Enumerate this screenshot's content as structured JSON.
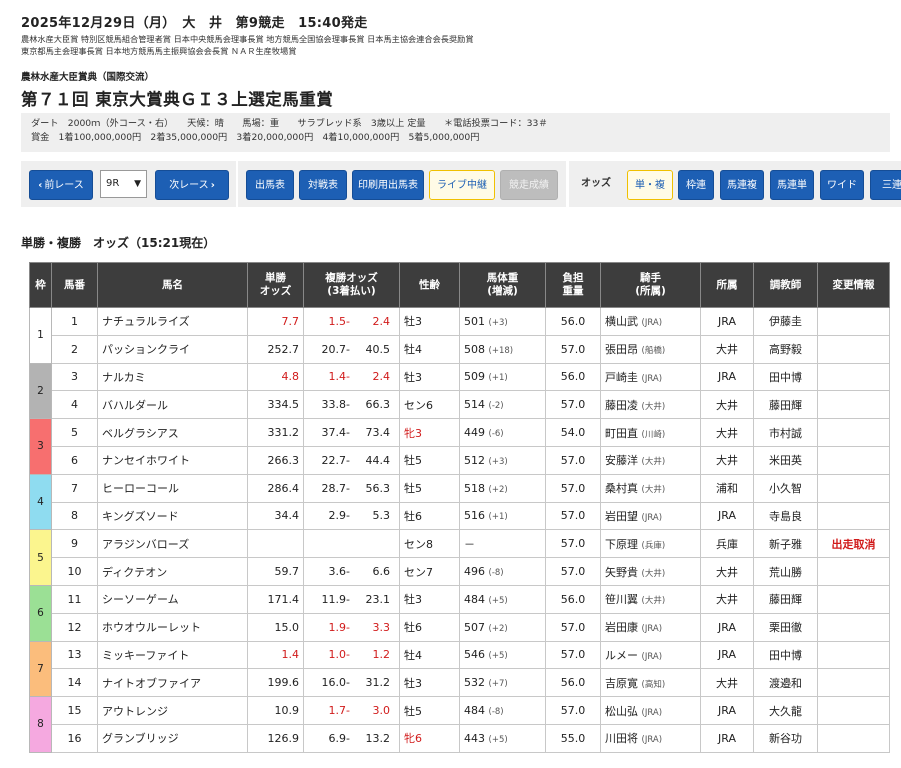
{
  "header": {
    "date_line": "2025年12月29日（月）　大　井　第9競走　15:40発走",
    "sponsors": [
      "農林水産大臣賞 特別区競馬組合管理者賞 日本中央競馬会理事長賞 地方競馬全国協会理事長賞 日本馬主協会連合会長奨励賞",
      "東京都馬主会理事長賞 日本地方競馬馬主振興協会会長賞 ＮＡＲ生産牧場賞"
    ],
    "subtitle": "農林水産大臣賞典（国際交流）",
    "title": "第７１回 東京大賞典ＧＩ３上選定馬重賞"
  },
  "info": {
    "line1": "ダート　2000ｍ（外コース・右）　　天候：晴　　馬場：重　　サラブレッド系　3歳以上 定量　　＊電話投票コード：33＃",
    "line2": "賞金　1着100,000,000円　2着35,000,000円　3着20,000,000円　4着10,000,000円　5着5,000,000円"
  },
  "nav": {
    "prev_label": "前レース",
    "race_select": "9R",
    "next_label": "次レース",
    "mid_buttons": [
      "出馬表",
      "対戦表",
      "印刷用出馬表",
      "ライブ中継",
      "競走成績"
    ],
    "odds_label": "オッズ",
    "odds_buttons": [
      "単・複",
      "枠連",
      "馬連複",
      "馬連単",
      "ワイド",
      "三連"
    ]
  },
  "section_title": "単勝・複勝　オッズ（15:21現在）",
  "table": {
    "headers": {
      "waku": "枠",
      "umaban": "馬番",
      "name": "馬名",
      "win1": "単勝",
      "win2": "オッズ",
      "place1": "複勝オッズ",
      "place2": "(3着払い)",
      "sexage": "性齢",
      "weight1": "馬体重",
      "weight2": "(増減)",
      "burden1": "負担",
      "burden2": "重量",
      "jockey1": "騎手",
      "jockey2": "(所属)",
      "belong": "所属",
      "trainer": "調教師",
      "change": "変更情報"
    },
    "waku_groups": [
      {
        "waku": "1",
        "color": "#ffffff",
        "text": "#222222"
      },
      {
        "waku": "2",
        "color": "#b3b3b3",
        "text": "#222222"
      },
      {
        "waku": "3",
        "color": "#f76f6f",
        "text": "#222222"
      },
      {
        "waku": "4",
        "color": "#8fdcf0",
        "text": "#222222"
      },
      {
        "waku": "5",
        "color": "#fbf58e",
        "text": "#222222"
      },
      {
        "waku": "6",
        "color": "#9be095",
        "text": "#222222"
      },
      {
        "waku": "7",
        "color": "#fbbd7c",
        "text": "#222222"
      },
      {
        "waku": "8",
        "color": "#f5a9e0",
        "text": "#222222"
      }
    ],
    "rows": [
      {
        "num": "1",
        "name": "ナチュラルライズ",
        "win": "7.7",
        "win_red": true,
        "pl_low": "1.5-",
        "pl_high": "2.4",
        "pl_red": true,
        "sexage": "牡3",
        "sexage_red": false,
        "weight": "501",
        "diff": "(+3)",
        "burden": "56.0",
        "jockey": "横山武",
        "jockey_aff": "(JRA)",
        "belong": "JRA",
        "trainer": "伊藤圭",
        "change": ""
      },
      {
        "num": "2",
        "name": "パッションクライ",
        "win": "252.7",
        "win_red": false,
        "pl_low": "20.7-",
        "pl_high": "40.5",
        "pl_red": false,
        "sexage": "牡4",
        "sexage_red": false,
        "weight": "508",
        "diff": "(+18)",
        "burden": "57.0",
        "jockey": "張田昂",
        "jockey_aff": "(船橋)",
        "belong": "大井",
        "trainer": "高野毅",
        "change": ""
      },
      {
        "num": "3",
        "name": "ナルカミ",
        "win": "4.8",
        "win_red": true,
        "pl_low": "1.4-",
        "pl_high": "2.4",
        "pl_red": true,
        "sexage": "牡3",
        "sexage_red": false,
        "weight": "509",
        "diff": "(+1)",
        "burden": "56.0",
        "jockey": "戸崎圭",
        "jockey_aff": "(JRA)",
        "belong": "JRA",
        "trainer": "田中博",
        "change": ""
      },
      {
        "num": "4",
        "name": "バハルダール",
        "win": "334.5",
        "win_red": false,
        "pl_low": "33.8-",
        "pl_high": "66.3",
        "pl_red": false,
        "sexage": "セン6",
        "sexage_red": false,
        "weight": "514",
        "diff": "(-2)",
        "burden": "57.0",
        "jockey": "藤田凌",
        "jockey_aff": "(大井)",
        "belong": "大井",
        "trainer": "藤田輝",
        "change": ""
      },
      {
        "num": "5",
        "name": "ベルグラシアス",
        "win": "331.2",
        "win_red": false,
        "pl_low": "37.4-",
        "pl_high": "73.4",
        "pl_red": false,
        "sexage": "牝3",
        "sexage_red": true,
        "weight": "449",
        "diff": "(-6)",
        "burden": "54.0",
        "jockey": "町田直",
        "jockey_aff": "(川崎)",
        "belong": "大井",
        "trainer": "市村誠",
        "change": ""
      },
      {
        "num": "6",
        "name": "ナンセイホワイト",
        "win": "266.3",
        "win_red": false,
        "pl_low": "22.7-",
        "pl_high": "44.4",
        "pl_red": false,
        "sexage": "牡5",
        "sexage_red": false,
        "weight": "512",
        "diff": "(+3)",
        "burden": "57.0",
        "jockey": "安藤洋",
        "jockey_aff": "(大井)",
        "belong": "大井",
        "trainer": "米田英",
        "change": ""
      },
      {
        "num": "7",
        "name": "ヒーローコール",
        "win": "286.4",
        "win_red": false,
        "pl_low": "28.7-",
        "pl_high": "56.3",
        "pl_red": false,
        "sexage": "牡5",
        "sexage_red": false,
        "weight": "518",
        "diff": "(+2)",
        "burden": "57.0",
        "jockey": "桑村真",
        "jockey_aff": "(大井)",
        "belong": "浦和",
        "trainer": "小久智",
        "change": ""
      },
      {
        "num": "8",
        "name": "キングズソード",
        "win": "34.4",
        "win_red": false,
        "pl_low": "2.9-",
        "pl_high": "5.3",
        "pl_red": false,
        "sexage": "牡6",
        "sexage_red": false,
        "weight": "516",
        "diff": "(+1)",
        "burden": "57.0",
        "jockey": "岩田望",
        "jockey_aff": "(JRA)",
        "belong": "JRA",
        "trainer": "寺島良",
        "change": ""
      },
      {
        "num": "9",
        "name": "アラジンバローズ",
        "win": "",
        "win_red": false,
        "pl_low": "",
        "pl_high": "",
        "pl_red": false,
        "sexage": "セン8",
        "sexage_red": false,
        "weight": "－",
        "diff": "",
        "burden": "57.0",
        "jockey": "下原理",
        "jockey_aff": "(兵庫)",
        "belong": "兵庫",
        "trainer": "新子雅",
        "change": "出走取消"
      },
      {
        "num": "10",
        "name": "ディクテオン",
        "win": "59.7",
        "win_red": false,
        "pl_low": "3.6-",
        "pl_high": "6.6",
        "pl_red": false,
        "sexage": "セン7",
        "sexage_red": false,
        "weight": "496",
        "diff": "(-8)",
        "burden": "57.0",
        "jockey": "矢野貴",
        "jockey_aff": "(大井)",
        "belong": "大井",
        "trainer": "荒山勝",
        "change": ""
      },
      {
        "num": "11",
        "name": "シーソーゲーム",
        "win": "171.4",
        "win_red": false,
        "pl_low": "11.9-",
        "pl_high": "23.1",
        "pl_red": false,
        "sexage": "牡3",
        "sexage_red": false,
        "weight": "484",
        "diff": "(+5)",
        "burden": "56.0",
        "jockey": "笹川翼",
        "jockey_aff": "(大井)",
        "belong": "大井",
        "trainer": "藤田輝",
        "change": ""
      },
      {
        "num": "12",
        "name": "ホウオウルーレット",
        "win": "15.0",
        "win_red": false,
        "pl_low": "1.9-",
        "pl_high": "3.3",
        "pl_red": true,
        "sexage": "牡6",
        "sexage_red": false,
        "weight": "507",
        "diff": "(+2)",
        "burden": "57.0",
        "jockey": "岩田康",
        "jockey_aff": "(JRA)",
        "belong": "JRA",
        "trainer": "栗田徹",
        "change": ""
      },
      {
        "num": "13",
        "name": "ミッキーファイト",
        "win": "1.4",
        "win_red": true,
        "pl_low": "1.0-",
        "pl_high": "1.2",
        "pl_red": true,
        "sexage": "牡4",
        "sexage_red": false,
        "weight": "546",
        "diff": "(+5)",
        "burden": "57.0",
        "jockey": "ルメー",
        "jockey_aff": "(JRA)",
        "belong": "JRA",
        "trainer": "田中博",
        "change": ""
      },
      {
        "num": "14",
        "name": "ナイトオブファイア",
        "win": "199.6",
        "win_red": false,
        "pl_low": "16.0-",
        "pl_high": "31.2",
        "pl_red": false,
        "sexage": "牡3",
        "sexage_red": false,
        "weight": "532",
        "diff": "(+7)",
        "burden": "56.0",
        "jockey": "吉原寛",
        "jockey_aff": "(高知)",
        "belong": "大井",
        "trainer": "渡邉和",
        "change": ""
      },
      {
        "num": "15",
        "name": "アウトレンジ",
        "win": "10.9",
        "win_red": false,
        "pl_low": "1.7-",
        "pl_high": "3.0",
        "pl_red": true,
        "sexage": "牡5",
        "sexage_red": false,
        "weight": "484",
        "diff": "(-8)",
        "burden": "57.0",
        "jockey": "松山弘",
        "jockey_aff": "(JRA)",
        "belong": "JRA",
        "trainer": "大久龍",
        "change": ""
      },
      {
        "num": "16",
        "name": "グランブリッジ",
        "win": "126.9",
        "win_red": false,
        "pl_low": "6.9-",
        "pl_high": "13.2",
        "pl_red": false,
        "sexage": "牝6",
        "sexage_red": true,
        "weight": "443",
        "diff": "(+5)",
        "burden": "55.0",
        "jockey": "川田将",
        "jockey_aff": "(JRA)",
        "belong": "JRA",
        "trainer": "新谷功",
        "change": ""
      }
    ]
  }
}
